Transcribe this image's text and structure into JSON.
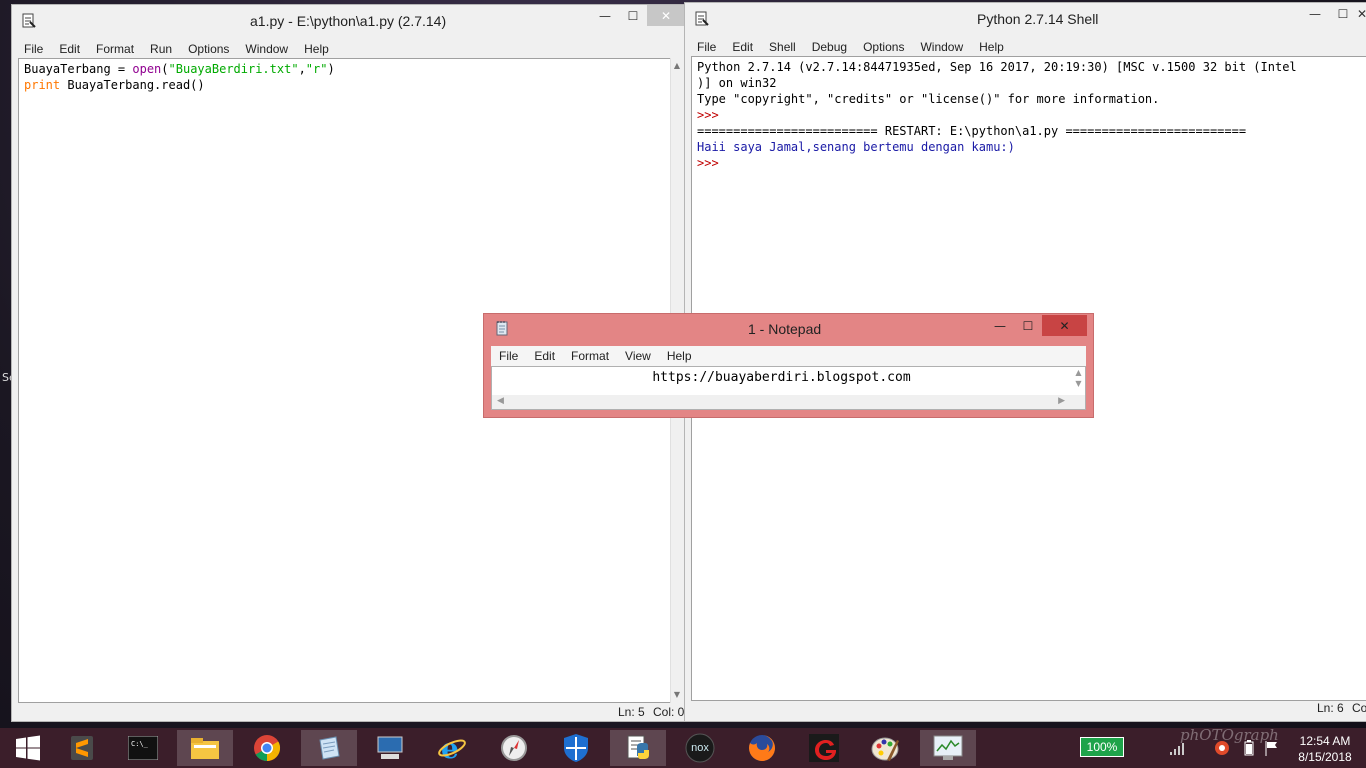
{
  "desktop": {
    "edge_text": "Se"
  },
  "editor": {
    "title": "a1.py - E:\\python\\a1.py (2.7.14)",
    "menu": [
      "File",
      "Edit",
      "Format",
      "Run",
      "Options",
      "Window",
      "Help"
    ],
    "code": {
      "line1_var": "BuayaTerbang = ",
      "line1_fn": "open",
      "line1_open_paren": "(",
      "line1_str1": "\"BuayaBerdiri.txt\"",
      "line1_comma": ",",
      "line1_str2": "\"r\"",
      "line1_close_paren": ")",
      "line2_kw": "print",
      "line2_rest": " BuayaTerbang.read()"
    },
    "status": {
      "ln": "Ln: 5",
      "col": "Col: 0"
    }
  },
  "shell": {
    "title": "Python 2.7.14 Shell",
    "menu": [
      "File",
      "Edit",
      "Shell",
      "Debug",
      "Options",
      "Window",
      "Help"
    ],
    "lines": {
      "banner1": "Python 2.7.14 (v2.7.14:84471935ed, Sep 16 2017, 20:19:30) [MSC v.1500 32 bit (Intel",
      "banner2": ")] on win32",
      "banner3": "Type \"copyright\", \"credits\" or \"license()\" for more information.",
      "prompt1": ">>> ",
      "restart": "========================= RESTART: E:\\python\\a1.py =========================",
      "output": "Haii saya Jamal,senang bertemu dengan kamu:)",
      "prompt2": ">>> "
    },
    "status": {
      "ln": "Ln: 6",
      "col": "Co"
    }
  },
  "notepad": {
    "title": "1 - Notepad",
    "menu": [
      "File",
      "Edit",
      "Format",
      "View",
      "Help"
    ],
    "content": "https://buayaberdiri.blogspot.com"
  },
  "window_buttons": {
    "minimize": "—",
    "maximize": "☐",
    "close": "✕"
  },
  "taskbar": {
    "apps": [
      "start-icon",
      "sublime-text-icon",
      "command-prompt-icon",
      "file-explorer-icon",
      "chrome-icon",
      "notepad-icon",
      "remote-desktop-icon",
      "internet-explorer-icon",
      "compass-icon",
      "defender-icon",
      "python-idle-icon",
      "nox-icon",
      "firefox-icon",
      "garena-icon",
      "paint-icon",
      "task-manager-icon"
    ],
    "nox_label": "nox",
    "battery": "100%",
    "watermark": "phOTOgraph",
    "time": "12:54 AM",
    "date": "8/15/2018"
  },
  "colors": {
    "taskbar": "#3b1e2a",
    "notepad_frame": "#e38585",
    "notepad_close": "#c84444",
    "battery_badge": "#1ea34a"
  }
}
